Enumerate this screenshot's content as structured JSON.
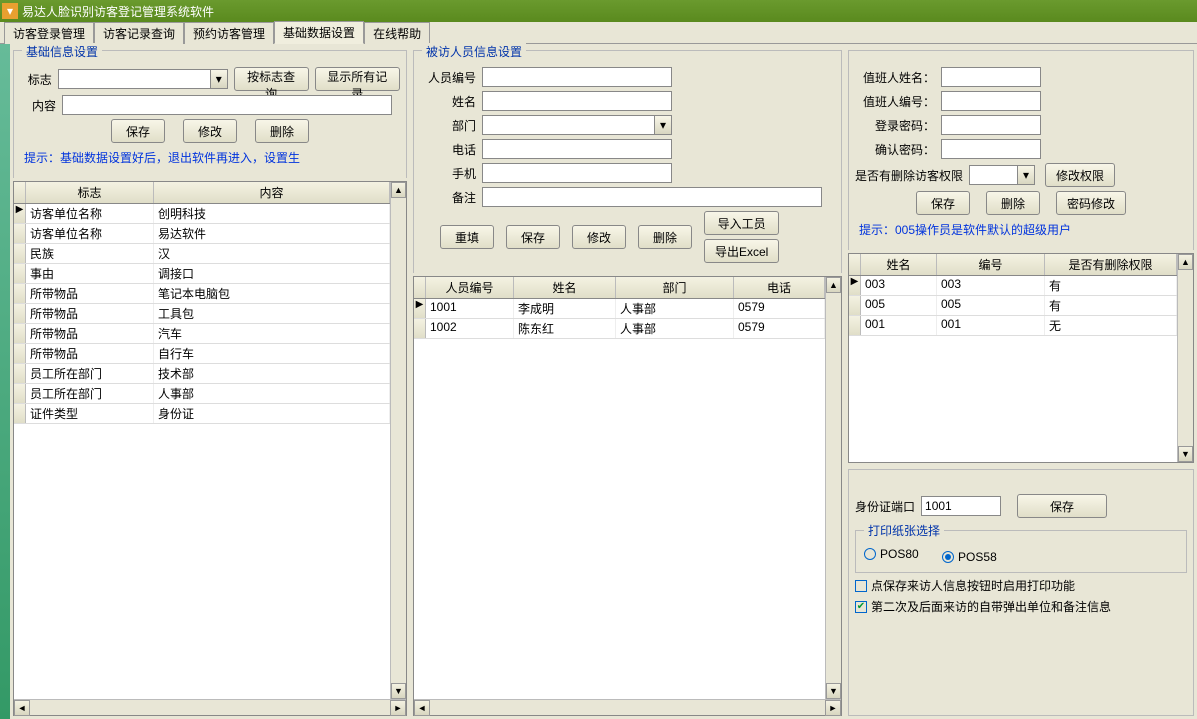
{
  "title": "易达人脸识别访客登记管理系统软件",
  "tabs": [
    "访客登录管理",
    "访客记录查询",
    "预约访客管理",
    "基础数据设置",
    "在线帮助"
  ],
  "active_tab": 3,
  "left": {
    "title": "基础信息设置",
    "mark_label": "标志",
    "content_label": "内容",
    "btn_query": "按标志查询",
    "btn_showall": "显示所有记录",
    "btn_save": "保存",
    "btn_edit": "修改",
    "btn_del": "删除",
    "hint": "提示：基础数据设置好后，退出软件再进入，设置生",
    "cols": [
      "标志",
      "内容"
    ],
    "rows": [
      [
        "访客单位名称",
        "创明科技"
      ],
      [
        "访客单位名称",
        "易达软件"
      ],
      [
        "民族",
        "汉"
      ],
      [
        "事由",
        "调接口"
      ],
      [
        "所带物品",
        "笔记本电脑包"
      ],
      [
        "所带物品",
        "工具包"
      ],
      [
        "所带物品",
        "汽车"
      ],
      [
        "所带物品",
        "自行车"
      ],
      [
        "员工所在部门",
        "技术部"
      ],
      [
        "员工所在部门",
        "人事部"
      ],
      [
        "证件类型",
        "身份证"
      ]
    ]
  },
  "mid": {
    "title": "被访人员信息设置",
    "labels": {
      "id": "人员编号",
      "name": "姓名",
      "dept": "部门",
      "tel": "电话",
      "mobile": "手机",
      "note": "备注"
    },
    "btn_reset": "重填",
    "btn_save": "保存",
    "btn_edit": "修改",
    "btn_del": "删除",
    "btn_import": "导入工员",
    "btn_export": "导出Excel",
    "cols": [
      "人员编号",
      "姓名",
      "部门",
      "电话"
    ],
    "rows": [
      [
        "1001",
        "李成明",
        "人事部",
        "0579"
      ],
      [
        "1002",
        "陈东红",
        "人事部",
        "0579"
      ]
    ]
  },
  "right": {
    "labels": {
      "duty_name": "值班人姓名：",
      "duty_id": "值班人编号：",
      "pwd": "登录密码：",
      "pwd2": "确认密码：",
      "perm": "是否有删除访客权限"
    },
    "btn_perm": "修改权限",
    "btn_save": "保存",
    "btn_del": "删除",
    "btn_pwd": "密码修改",
    "hint": "提示：005操作员是软件默认的超级用户",
    "cols": [
      "姓名",
      "编号",
      "是否有删除权限"
    ],
    "rows": [
      [
        "003",
        "003",
        "有"
      ],
      [
        "005",
        "005",
        "有"
      ],
      [
        "001",
        "001",
        "无"
      ]
    ],
    "bottom": {
      "port_label": "身份证端口",
      "port_value": "1001",
      "btn_save": "保存",
      "paper_title": "打印纸张选择",
      "opt1": "POS80",
      "opt2": "POS58",
      "opt_sel": 1,
      "chk1": "点保存来访人信息按钮时启用打印功能",
      "chk1_on": false,
      "chk2": "第二次及后面来访的自带弹出单位和备注信息",
      "chk2_on": true
    }
  }
}
